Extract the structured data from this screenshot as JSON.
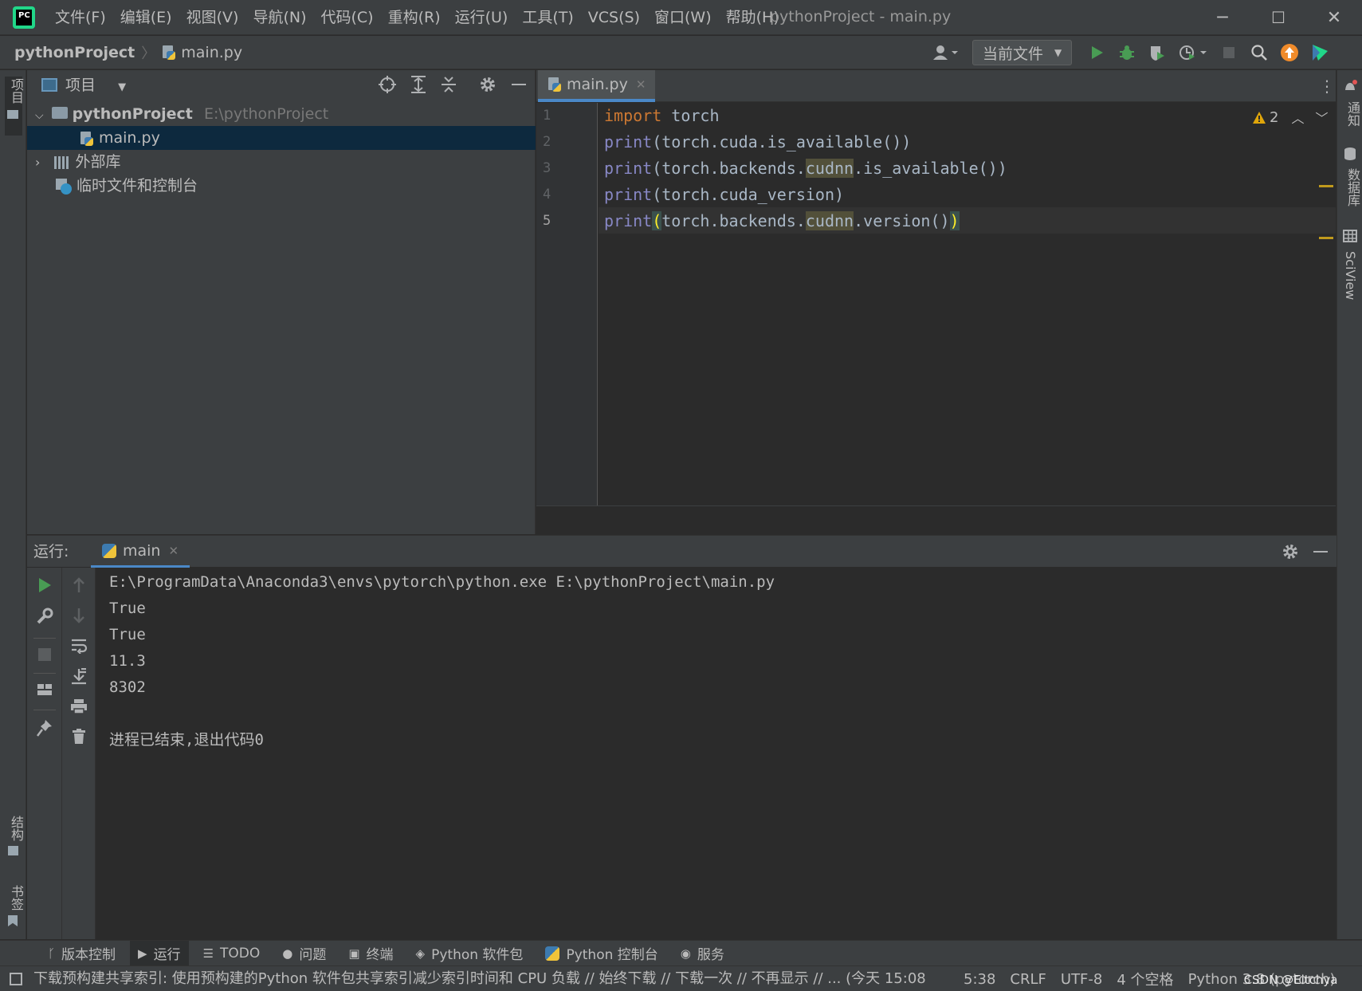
{
  "window": {
    "title": "pythonProject - main.py",
    "menu": [
      "文件(F)",
      "编辑(E)",
      "视图(V)",
      "导航(N)",
      "代码(C)",
      "重构(R)",
      "运行(U)",
      "工具(T)",
      "VCS(S)",
      "窗口(W)",
      "帮助(H)"
    ],
    "controls": {
      "minimize": "─",
      "maximize": "☐",
      "close": "✕"
    }
  },
  "breadcrumb": {
    "project": "pythonProject",
    "file": "main.py"
  },
  "toolbar": {
    "run_config": "当前文件"
  },
  "left_strip": {
    "project": "项目",
    "structure": "结构",
    "bookmarks": "书签"
  },
  "right_strip": {
    "notifications": "通知",
    "database": "数据库",
    "sciview": "SciView"
  },
  "project_panel": {
    "title": "项目",
    "tree": [
      {
        "label": "pythonProject",
        "path": "E:\\pythonProject"
      },
      {
        "label": "main.py"
      },
      {
        "label": "外部库"
      },
      {
        "label": "临时文件和控制台"
      }
    ]
  },
  "editor": {
    "tab": "main.py",
    "warnings": "2",
    "line_numbers": [
      "1",
      "2",
      "3",
      "4",
      "5"
    ]
  },
  "run_panel": {
    "label": "运行:",
    "tab": "main",
    "output": [
      "E:\\ProgramData\\Anaconda3\\envs\\pytorch\\python.exe E:\\pythonProject\\main.py",
      "True",
      "True",
      "11.3",
      "8302",
      "",
      "进程已结束,退出代码0"
    ]
  },
  "bottom_tools": [
    "版本控制",
    "运行",
    "TODO",
    "问题",
    "终端",
    "Python 软件包",
    "Python 控制台",
    "服务"
  ],
  "statusbar": {
    "message": "下载预构建共享索引: 使用预构建的Python 软件包共享索引减少索引时间和 CPU 负载 // 始终下载 // 下载一次 // 不再显示 // ... (今天 15:08)",
    "position": "5:38",
    "line_sep": "CRLF",
    "encoding": "UTF-8",
    "indent": "4 个空格",
    "interpreter": "Python 3.8 (pytorch)",
    "watermark": "CSDN @Eitchya"
  },
  "colors": {
    "accent": "#4a88c7",
    "keyword": "#cc7832",
    "builtin": "#8888c6",
    "run_green": "#499c54"
  }
}
